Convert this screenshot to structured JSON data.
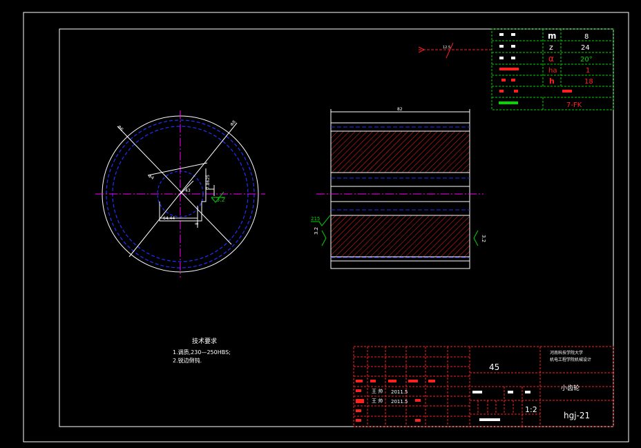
{
  "colors": {
    "background": "#000000",
    "frame": "#ffffff",
    "outline": "#ffffff",
    "hidden": "#2030ff",
    "center": "#ff00ff",
    "hatch": "#ff2020",
    "dimension": "#ffffff",
    "roughness": "#00d800",
    "title_grid": "#ff2020",
    "param_grid": "#00d800"
  },
  "params": {
    "m_symbol": "m",
    "m_value": "8",
    "z_symbol": "z",
    "z_value": "24",
    "alpha_symbol": "α",
    "alpha_value": "20°",
    "ha_symbol": "ha",
    "ha_value": "1",
    "h_symbol": "h",
    "h_value": "18",
    "grade_value": "7-FK"
  },
  "dims": {
    "d1": "Φ6",
    "d2": "Φ8",
    "d_bore": "Φ4",
    "r43": "43",
    "keyway": "7.8625",
    "hub": "64.44",
    "small": "8",
    "width": "82",
    "rough_face": "3.2",
    "rough_keyway": "3.2",
    "rough_bore": "215",
    "rough_left": "3.2",
    "rough_right": "3.2",
    "top_rough": "12.5"
  },
  "notes": {
    "title": "技术要求",
    "line1": "1.调质,230—250HBS;",
    "line2": "2.锐边倒钝."
  },
  "titleblock": {
    "material": "45",
    "school": "河南科技学院大学",
    "dept": "机电工程学院机械设计",
    "part_name": "小齿轮",
    "scale": "1:2",
    "drawing_no": "hgj-21",
    "designer": "王 帅",
    "designer_date": "2011.5",
    "checker": "王 帅",
    "checker_date": "2011.5"
  }
}
